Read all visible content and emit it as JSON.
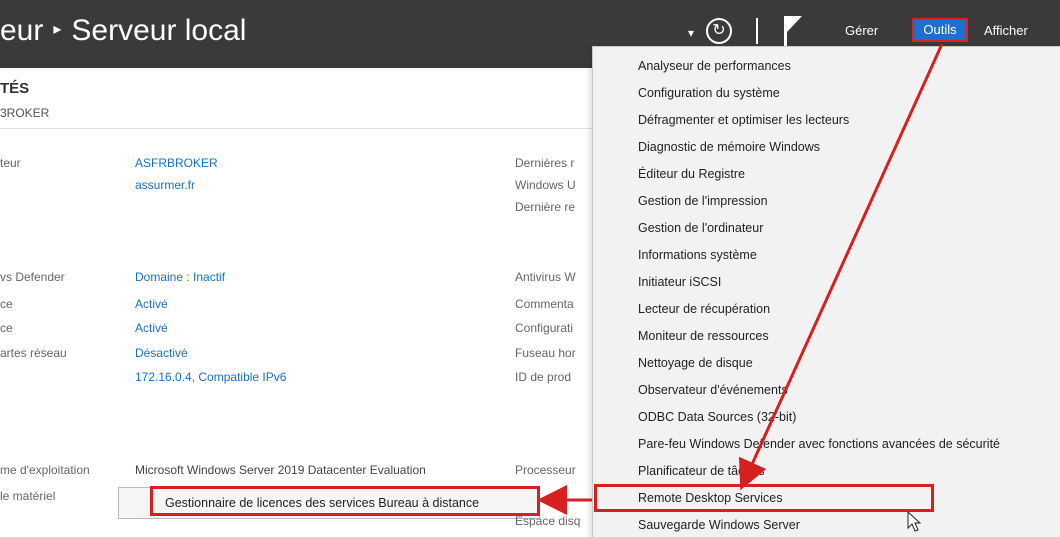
{
  "header": {
    "breadcrumb_parent": "eur",
    "breadcrumb_separator": "▸",
    "breadcrumb_current": "Serveur local",
    "menus": {
      "gerer": "Gérer",
      "outils": "Outils",
      "afficher": "Afficher"
    }
  },
  "properties": {
    "title": "TÉS",
    "subtitle": "3ROKER",
    "left_rows": [
      {
        "label": "teur",
        "value": "ASFRBROKER"
      },
      {
        "label": "",
        "value": "assurmer.fr"
      },
      {
        "label": "vs Defender",
        "value": "Domaine : Inactif"
      },
      {
        "label": "ce",
        "value": "Activé"
      },
      {
        "label": "ce",
        "value": "Activé"
      },
      {
        "label": "artes réseau",
        "value": "Désactivé"
      },
      {
        "label": "",
        "value": "172.16.0.4, Compatible IPv6"
      }
    ],
    "os_label": "me d'exploitation",
    "os_value": "Microsoft Windows Server 2019 Datacenter Evaluation",
    "hardware_label": "le matériel",
    "right_labels": [
      "Dernières r",
      "Windows U",
      "Dernière re",
      "Antivirus W",
      "Commenta",
      "Configurati",
      "Fuseau hor",
      "ID de prod",
      "Processeur",
      "Espace disq"
    ]
  },
  "tools_menu": {
    "items": [
      "Analyseur de performances",
      "Configuration du système",
      "Défragmenter et optimiser les lecteurs",
      "Diagnostic de mémoire Windows",
      "Éditeur du Registre",
      "Gestion de l'impression",
      "Gestion de l'ordinateur",
      "Informations système",
      "Initiateur iSCSI",
      "Lecteur de récupération",
      "Moniteur de ressources",
      "Nettoyage de disque",
      "Observateur d'événements",
      "ODBC Data Sources (32-bit)",
      "Pare-feu Windows Defender avec fonctions avancées de sécurité",
      "Planificateur de tâches",
      "Remote Desktop Services",
      "Sauvegarde Windows Server"
    ]
  },
  "submenu": {
    "item": "Gestionnaire de licences des services Bureau à distance"
  },
  "colors": {
    "titlebar": "#3a3a3a",
    "accent": "#1f6fcf",
    "annotation": "#d62020",
    "link": "#1a6fc9"
  }
}
